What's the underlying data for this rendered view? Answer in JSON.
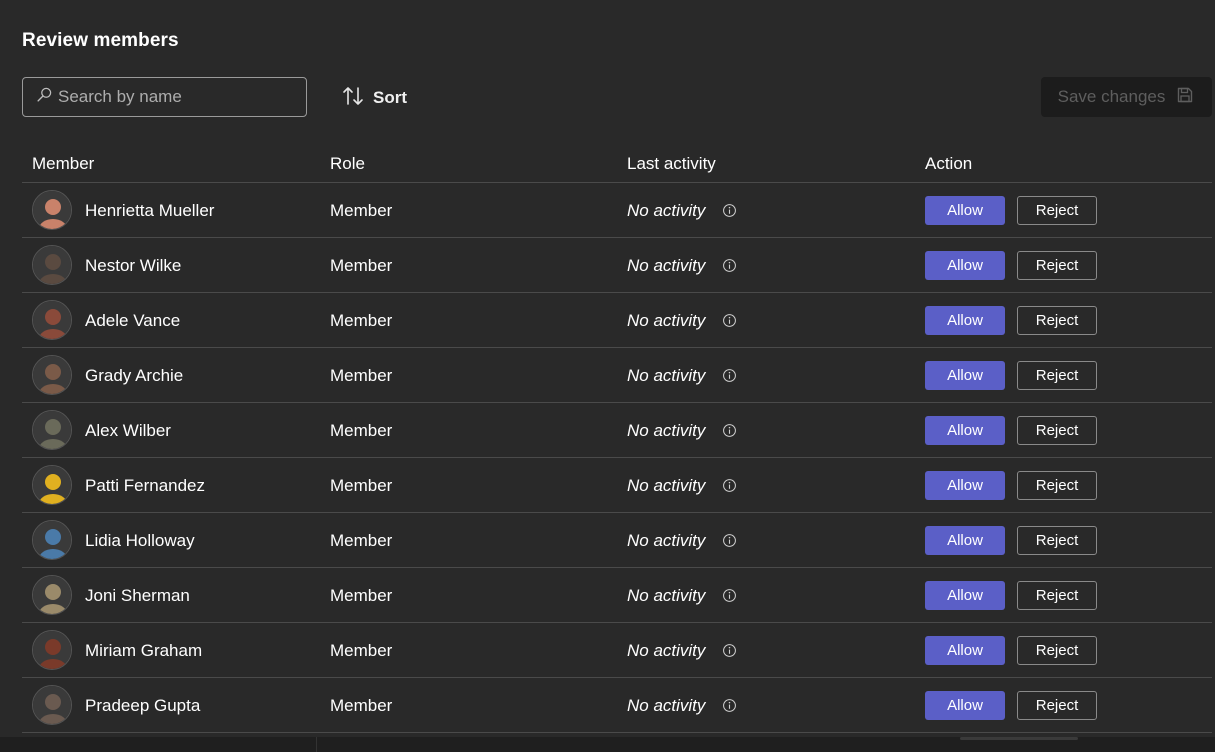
{
  "page": {
    "title": "Review members"
  },
  "search": {
    "placeholder": "Search by name"
  },
  "toolbar": {
    "sort_label": "Sort",
    "save_label": "Save changes"
  },
  "table": {
    "headers": {
      "member": "Member",
      "role": "Role",
      "last_activity": "Last activity",
      "action": "Action"
    },
    "rows": [
      {
        "name": "Henrietta Mueller",
        "role": "Member",
        "activity": "No activity",
        "allow": "Allow",
        "reject": "Reject",
        "avatar_color": "#c9826a"
      },
      {
        "name": "Nestor Wilke",
        "role": "Member",
        "activity": "No activity",
        "allow": "Allow",
        "reject": "Reject",
        "avatar_color": "#5a4a40"
      },
      {
        "name": "Adele Vance",
        "role": "Member",
        "activity": "No activity",
        "allow": "Allow",
        "reject": "Reject",
        "avatar_color": "#8a4a3a"
      },
      {
        "name": "Grady Archie",
        "role": "Member",
        "activity": "No activity",
        "allow": "Allow",
        "reject": "Reject",
        "avatar_color": "#7a5a48"
      },
      {
        "name": "Alex Wilber",
        "role": "Member",
        "activity": "No activity",
        "allow": "Allow",
        "reject": "Reject",
        "avatar_color": "#6a6a5a"
      },
      {
        "name": "Patti Fernandez",
        "role": "Member",
        "activity": "No activity",
        "allow": "Allow",
        "reject": "Reject",
        "avatar_color": "#e0b020"
      },
      {
        "name": "Lidia Holloway",
        "role": "Member",
        "activity": "No activity",
        "allow": "Allow",
        "reject": "Reject",
        "avatar_color": "#4a7aa8"
      },
      {
        "name": "Joni Sherman",
        "role": "Member",
        "activity": "No activity",
        "allow": "Allow",
        "reject": "Reject",
        "avatar_color": "#9a8a6a"
      },
      {
        "name": "Miriam Graham",
        "role": "Member",
        "activity": "No activity",
        "allow": "Allow",
        "reject": "Reject",
        "avatar_color": "#7a3a2a"
      },
      {
        "name": "Pradeep Gupta",
        "role": "Member",
        "activity": "No activity",
        "allow": "Allow",
        "reject": "Reject",
        "avatar_color": "#6a5a50"
      }
    ]
  },
  "colors": {
    "accent": "#5b5fc7",
    "background": "#292929",
    "divider": "#4a4a4a"
  },
  "icons": {
    "search": "search-icon",
    "sort": "sort-arrows-icon",
    "save": "save-disk-icon",
    "info": "info-icon"
  }
}
